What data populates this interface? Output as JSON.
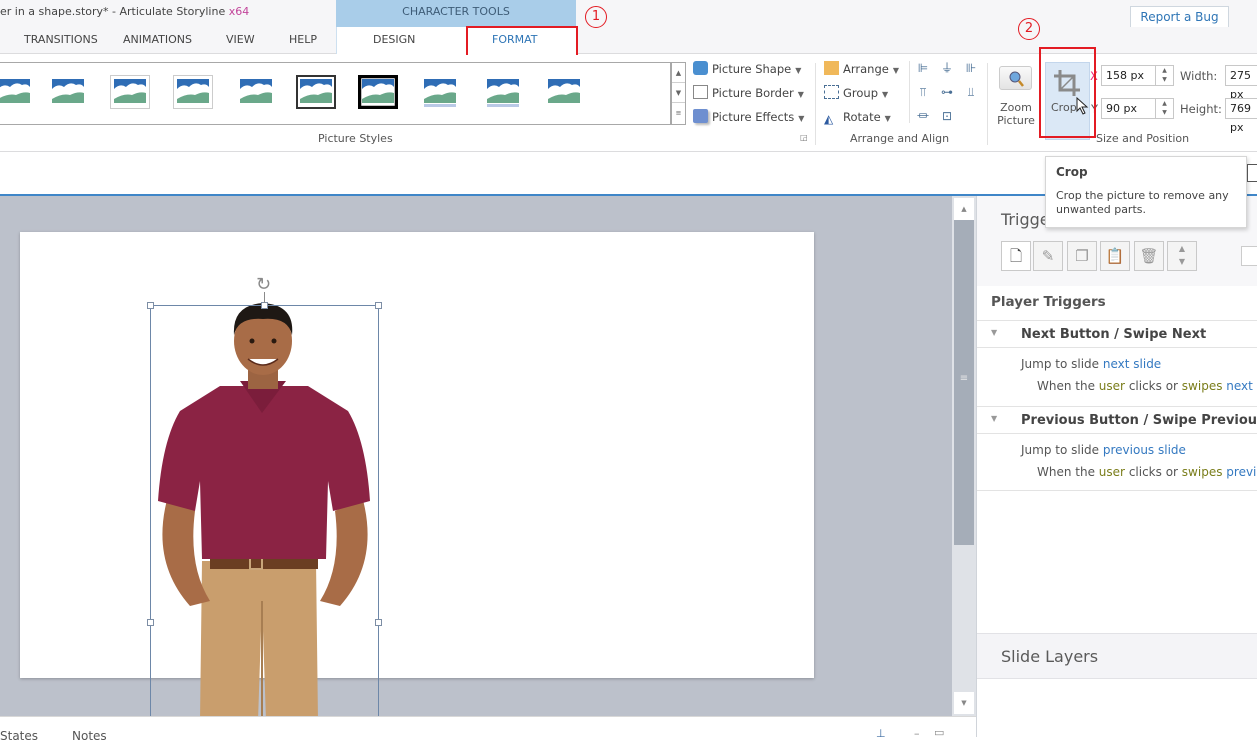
{
  "window": {
    "title": "er in a shape.story* -  Articulate Storyline",
    "arch": "x64",
    "contextual_group": "CHARACTER TOOLS",
    "report_bug": "Report a Bug"
  },
  "tabs": [
    {
      "label": "TRANSITIONS"
    },
    {
      "label": "ANIMATIONS"
    },
    {
      "label": "VIEW"
    },
    {
      "label": "HELP"
    },
    {
      "label": "DESIGN"
    },
    {
      "label": "FORMAT",
      "active": true
    }
  ],
  "callouts": [
    "1",
    "2"
  ],
  "ribbon": {
    "picture_styles": {
      "label": "Picture Styles",
      "styles": [
        "simple-frame-blue",
        "simple-frame-white",
        "thick-matte-white",
        "soft-shadow",
        "rotated-white",
        "metal-frame",
        "thick-black-frame",
        "reflected-rounded",
        "reflected-oval",
        "plain"
      ]
    },
    "picture_commands": [
      {
        "label": "Picture Shape",
        "icon": "picture-shape-icon"
      },
      {
        "label": "Picture Border",
        "icon": "picture-border-icon"
      },
      {
        "label": "Picture Effects",
        "icon": "picture-effects-icon"
      }
    ],
    "arrange": {
      "label": "Arrange and Align",
      "commands": [
        {
          "label": "Arrange",
          "icon": "arrange-icon"
        },
        {
          "label": "Group",
          "icon": "group-icon"
        },
        {
          "label": "Rotate",
          "icon": "rotate-icon"
        }
      ],
      "align_icons": [
        "align-left-icon",
        "align-center-icon",
        "align-right-icon",
        "align-top-icon",
        "align-middle-icon",
        "align-bottom-icon",
        "distribute-horizontal-icon",
        "distribute-vertical-icon"
      ]
    },
    "size_position": {
      "label": "Size and Position",
      "zoom_picture": "Zoom Picture",
      "crop": "Crop",
      "x_label": "X",
      "x_value": "158 px",
      "y_label": "Y",
      "y_value": "90 px",
      "width_label": "Width:",
      "width_value": "275 px",
      "height_label": "Height:",
      "height_value": "769 px"
    }
  },
  "tooltip": {
    "title": "Crop",
    "body": "Crop the picture to remove any unwanted parts."
  },
  "triggers": {
    "title": "Triggers",
    "toolbar": [
      "new-trigger-icon",
      "edit-trigger-icon",
      "copy-trigger-icon",
      "paste-trigger-icon",
      "delete-trigger-icon",
      "move-trigger-icon"
    ],
    "section_title": "Player Triggers",
    "groups": [
      {
        "name": "Next Button / Swipe Next",
        "action_prefix": "Jump to slide",
        "action_target": "next slide",
        "when_prefix": "When the",
        "when_user": "user",
        "when_mid": "clicks or",
        "when_verb": "swipes",
        "when_target": "next"
      },
      {
        "name": "Previous Button / Swipe Previous",
        "action_prefix": "Jump to slide",
        "action_target": "previous slide",
        "when_prefix": "When the",
        "when_user": "user",
        "when_mid": "clicks or",
        "when_verb": "swipes",
        "when_target": "previous"
      }
    ]
  },
  "slide_layers": {
    "title": "Slide Layers"
  },
  "bottom_tabs": [
    "States",
    "Notes"
  ],
  "colors": {
    "accent": "#3f86c8",
    "highlight": "#e31b23",
    "contextual": "#a9cde9",
    "link": "#3479c1"
  }
}
